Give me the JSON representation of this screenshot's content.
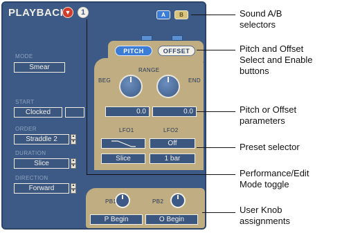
{
  "header": {
    "title": "PLAYBACK",
    "mode_icon": "mode-toggle-icon",
    "number_badge": "1"
  },
  "sound_ab": {
    "a_label": "A",
    "b_label": "B"
  },
  "pitch_offset": {
    "pitch_label": "PITCH",
    "offset_label": "OFFSET"
  },
  "left": {
    "mode_label": "MODE",
    "mode_value": "Smear",
    "start_label": "START",
    "start_value": "Clocked",
    "start_extra": "",
    "order_label": "ORDER",
    "order_value": "Straddle 2",
    "duration_label": "DURATION",
    "duration_value": "Slice",
    "direction_label": "DIRECTION",
    "direction_value": "Forward"
  },
  "range": {
    "label": "RANGE",
    "beg_label": "BEG",
    "end_label": "END",
    "beg_value": "0.0",
    "end_value": "0.0"
  },
  "lfo": {
    "lfo1_label": "LFO1",
    "lfo2_label": "LFO2",
    "lfo1_shape": "ramp-down-wave-icon",
    "lfo2_value": "Off",
    "lfo1_sync": "Slice",
    "lfo2_sync": "1 bar"
  },
  "user_knobs": {
    "pb1_label": "PB1",
    "pb2_label": "PB2",
    "pb1_value": "P Begin",
    "pb2_value": "O Begin"
  },
  "callouts": {
    "sound_ab": [
      "Sound A/B",
      "selectors"
    ],
    "pitch_offset": [
      "Pitch and Offset",
      "Select and Enable",
      "buttons"
    ],
    "params": [
      "Pitch or Offset",
      "parameters"
    ],
    "preset": "Preset selector",
    "perf_edit": [
      "Performance/Edit",
      "Mode toggle"
    ],
    "user_knob": [
      "User Knob",
      "assignments"
    ]
  },
  "colors": {
    "panel": "#3d5a86",
    "tan": "#c0ad82",
    "accent_red": "#d23a2c",
    "pitch_active": "#3b7cd6"
  }
}
